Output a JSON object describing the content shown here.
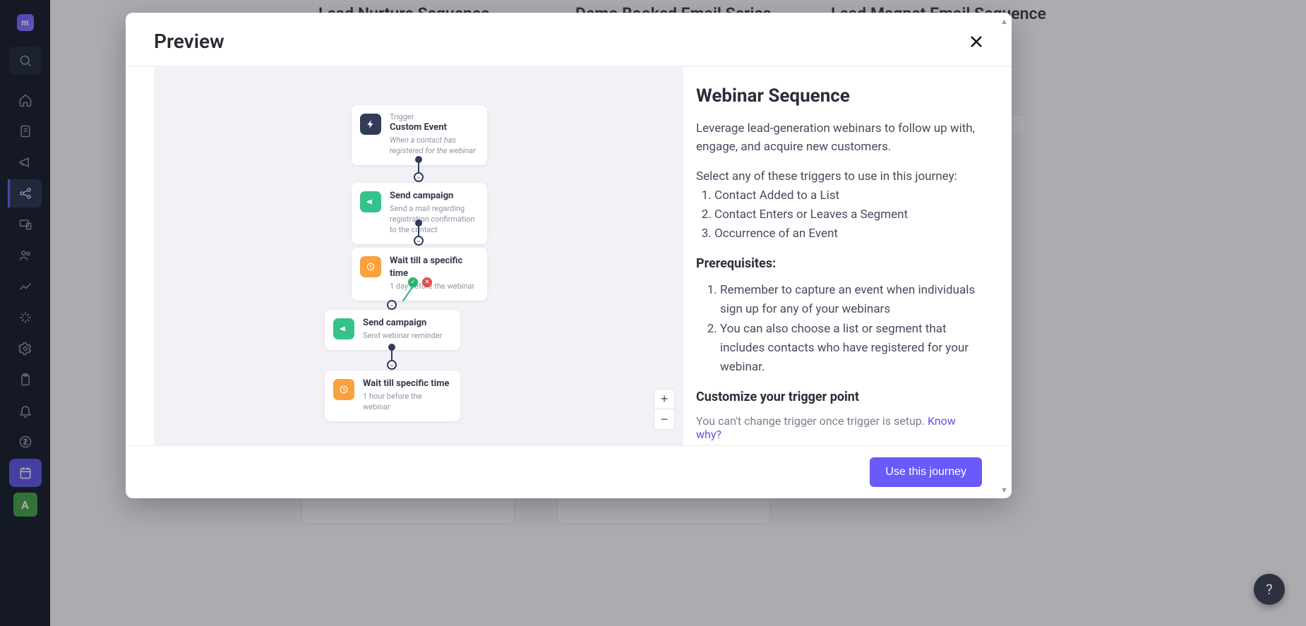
{
  "sidebar": {
    "logo_letter": "m",
    "avatar_letter": "A"
  },
  "background": {
    "card1": "Lead Nurture Sequence",
    "card2": "Demo Booked Email Series",
    "card3": "Lead Magnet Email Sequence"
  },
  "modal": {
    "title": "Preview",
    "use_button": "Use this journey"
  },
  "flow": {
    "n1": {
      "label": "Trigger",
      "title": "Custom Event",
      "desc": "When a contact has registered for the webinar"
    },
    "n2": {
      "title": "Send campaign",
      "desc": "Send a mail regarding registration confirmation to the contact"
    },
    "n3": {
      "title": "Wait till a specific time",
      "desc": "1 day before the webinar"
    },
    "n4": {
      "title": "Send campaign",
      "desc": "Send webinar reminder"
    },
    "n5": {
      "title": "Wait till specific time",
      "desc": "1 hour before the webinar"
    }
  },
  "info": {
    "heading": "Webinar Sequence",
    "intro": "Leverage lead-generation webinars to follow up with, engage, and acquire new customers.",
    "triggers_intro": "Select any of these triggers to use in this journey:",
    "triggers": {
      "t1": "Contact Added to a List",
      "t2": "Contact Enters or Leaves a Segment",
      "t3": "Occurrence of an Event"
    },
    "prereq_heading": "Prerequisites:",
    "prereqs": {
      "p1": "Remember to capture an event when individuals sign up for any of your webinars",
      "p2": "You can also choose a list or segment that includes contacts who have registered for your webinar."
    },
    "customize_heading": "Customize your trigger point",
    "customize_note": "You can't change trigger once trigger is setup. ",
    "know_why": "Know why?"
  },
  "help": "?"
}
